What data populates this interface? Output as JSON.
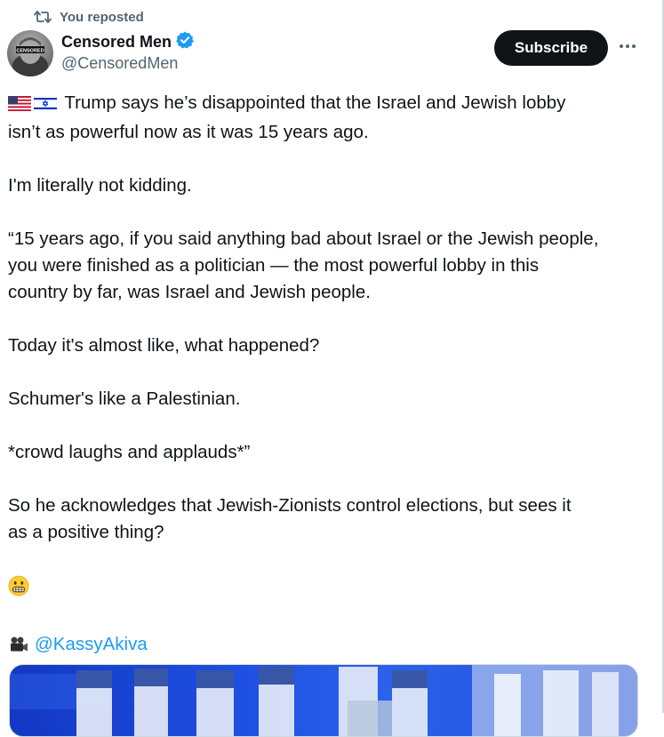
{
  "repost": {
    "icon": "repost-icon",
    "label": "You reposted"
  },
  "author": {
    "name": "Censored Men",
    "handle": "@CensoredMen",
    "verified": true,
    "verified_color": "#1d9bf0",
    "avatar_label": "CENSORED"
  },
  "actions": {
    "subscribe_label": "Subscribe",
    "more_icon": "more-dots-icon"
  },
  "tweet": {
    "line1": "Trump says he’s disappointed that the Israel and Jewish lobby",
    "line2": "isn’t as powerful now as it was 15 years ago.",
    "line3": "I'm literally not kidding.",
    "line4": "“15 years ago, if you said anything bad about Israel or the Jewish people,",
    "line5": "you were finished as a politician — the most powerful lobby in this",
    "line6": "country by far, was Israel and Jewish people.",
    "line7": "Today it's almost like, what happened?",
    "line8": "Schumer's like a Palestinian.",
    "line9": "*crowd laughs and applauds*”",
    "line10": "So he acknowledges that Jewish-Zionists control elections, but sees it",
    "line11": "as a positive thing?",
    "mention": "@KassyAkiva",
    "emojis": [
      "us-flag-icon",
      "israel-flag-icon",
      "grimacing-face-icon",
      "movie-camera-icon"
    ]
  },
  "colors": {
    "text": "#0f1419",
    "secondary": "#536471",
    "link": "#1d9bf0",
    "button_bg": "#0f1419"
  }
}
